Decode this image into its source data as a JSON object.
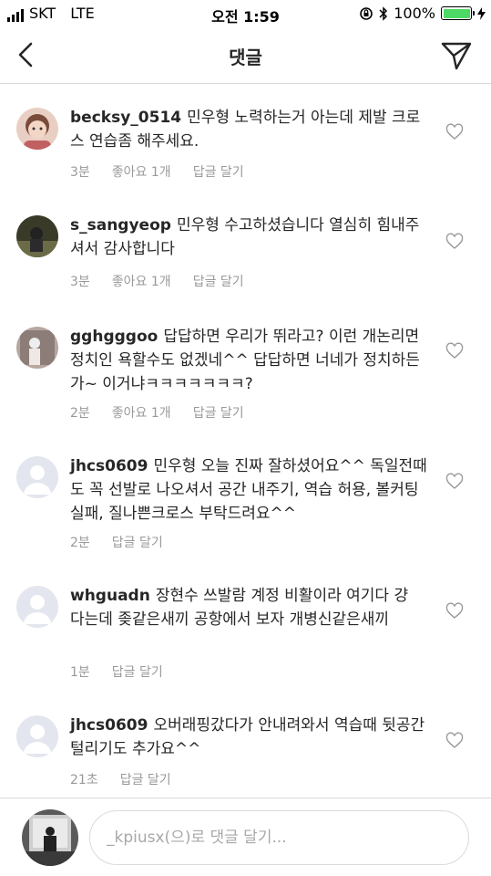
{
  "status_bar": {
    "carrier": "SKT",
    "network": "LTE",
    "time": "오전 1:59",
    "battery": "100%"
  },
  "header": {
    "title": "댓글"
  },
  "comments": [
    {
      "username": "becksy_0514",
      "text": "민우형 노력하는거 아는데 제발 크로스 연습좀 해주세요.",
      "time": "3분",
      "likes": "좋아요 1개",
      "reply": "답글 달기"
    },
    {
      "username": "s_sangyeop",
      "text": "민우형 수고하셨습니다 열심히 힘내주셔서 감사합니다",
      "time": "3분",
      "likes": "좋아요 1개",
      "reply": "답글 달기"
    },
    {
      "username": "gghgggoo",
      "text": "답답하면 우리가 뛰라고? 이런 개논리면 정치인 욕할수도 없겠네^^ 답답하면 너네가 정치하든가~ 이거냐ㅋㅋㅋㅋㅋㅋㅋ?",
      "time": "2분",
      "likes": "좋아요 1개",
      "reply": "답글 달기"
    },
    {
      "username": "jhcs0609",
      "text": "민우형 오늘 진짜 잘하셨어요^^ 독일전때도 꼭 선발로 나오셔서 공간 내주기, 역습 허용, 볼커팅실패, 질나쁜크로스 부탁드려요^^",
      "time": "2분",
      "likes": "",
      "reply": "답글 달기"
    },
    {
      "username": "whguadn",
      "text": "장현수 쓰발람 계정 비활이라 여기다 걍 다는데 좆같은새끼 공항에서 보자 개병신같은새끼",
      "time": "1분",
      "likes": "",
      "reply": "답글 달기"
    },
    {
      "username": "jhcs0609",
      "text": "오버래핑갔다가 안내려와서 역습때 뒷공간 털리기도 추가요^^",
      "time": "21초",
      "likes": "",
      "reply": "답글 달기"
    }
  ],
  "compose": {
    "placeholder": "_kpiusx(으)로 댓글 달기..."
  },
  "colors": {
    "accent_battery": "#4cd964",
    "text": "#262626",
    "meta": "#999999",
    "border": "#dbdbdb"
  },
  "icons": [
    "back-chevron-icon",
    "send-paper-plane-icon",
    "heart-outline-icon",
    "default-avatar-icon"
  ]
}
